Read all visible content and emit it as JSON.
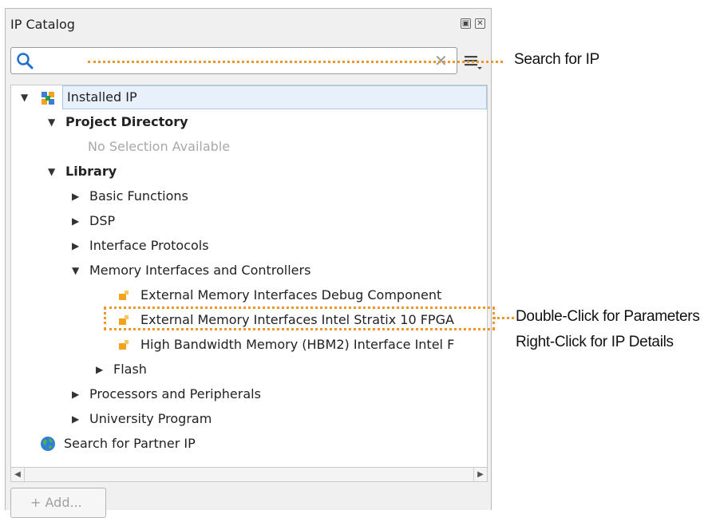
{
  "panel": {
    "title": "IP Catalog",
    "restore_glyph": "▣",
    "close_glyph": "✕"
  },
  "search": {
    "value": "",
    "placeholder": "",
    "clear_glyph": "✕"
  },
  "tree": {
    "installed_ip": "Installed IP",
    "project_directory": "Project Directory",
    "no_selection": "No Selection Available",
    "library": "Library",
    "basic_functions": "Basic Functions",
    "dsp": "DSP",
    "interface_protocols": "Interface Protocols",
    "memory_interfaces": "Memory Interfaces and Controllers",
    "emif_debug": "External Memory Interfaces Debug Component",
    "emif_stratix": "External Memory Interfaces Intel Stratix 10 FPGA",
    "hbm2": "High Bandwidth Memory (HBM2) Interface Intel F",
    "flash": "Flash",
    "processors": "Processors and Peripherals",
    "university": "University Program",
    "partner_ip": "Search for Partner IP"
  },
  "buttons": {
    "add": "+ Add..."
  },
  "callouts": {
    "search": "Search for IP",
    "double_click": "Double-Click for Parameters",
    "right_click": "Right-Click for IP Details"
  },
  "colors": {
    "callout_accent": "#f0962f",
    "selection": "#e8f1fb",
    "search_icon": "#1f6fd1"
  }
}
